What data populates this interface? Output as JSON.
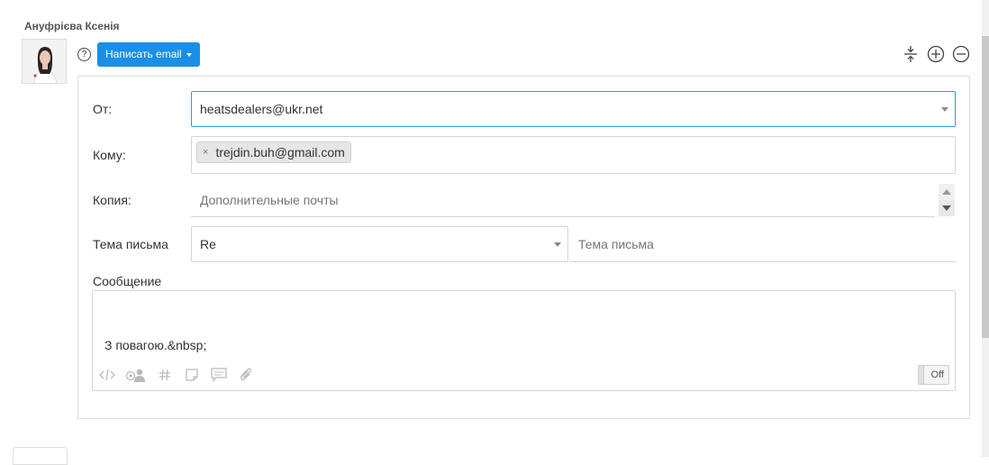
{
  "author": {
    "name": "Ануфрієва Ксенія"
  },
  "toolbar": {
    "help_glyph": "?",
    "compose_label": "Написать email"
  },
  "top_tools": [
    "collapse-icon",
    "plus-circle-icon",
    "minus-circle-icon"
  ],
  "form": {
    "from": {
      "label": "От:",
      "value": "heatsdealers@ukr.net"
    },
    "to": {
      "label": "Кому:",
      "tags": [
        "trejdin.buh@gmail.com"
      ],
      "remove_glyph": "×"
    },
    "cc": {
      "label": "Копия:",
      "placeholder": "Дополнительные почты"
    },
    "subject": {
      "label": "Тема письма",
      "prefix_value": "Re",
      "placeholder": "Тема письма"
    },
    "message": {
      "label": "Сообщение",
      "body": "З повагою.&nbsp;",
      "toolbar_icons": [
        "code-icon",
        "mention-user-icon",
        "hashtag-icon",
        "note-icon",
        "comment-icon",
        "attachment-icon"
      ],
      "toggle_label": "Off"
    }
  },
  "colors": {
    "accent": "#1a8fe8",
    "focus_border": "#2a9fd6"
  }
}
